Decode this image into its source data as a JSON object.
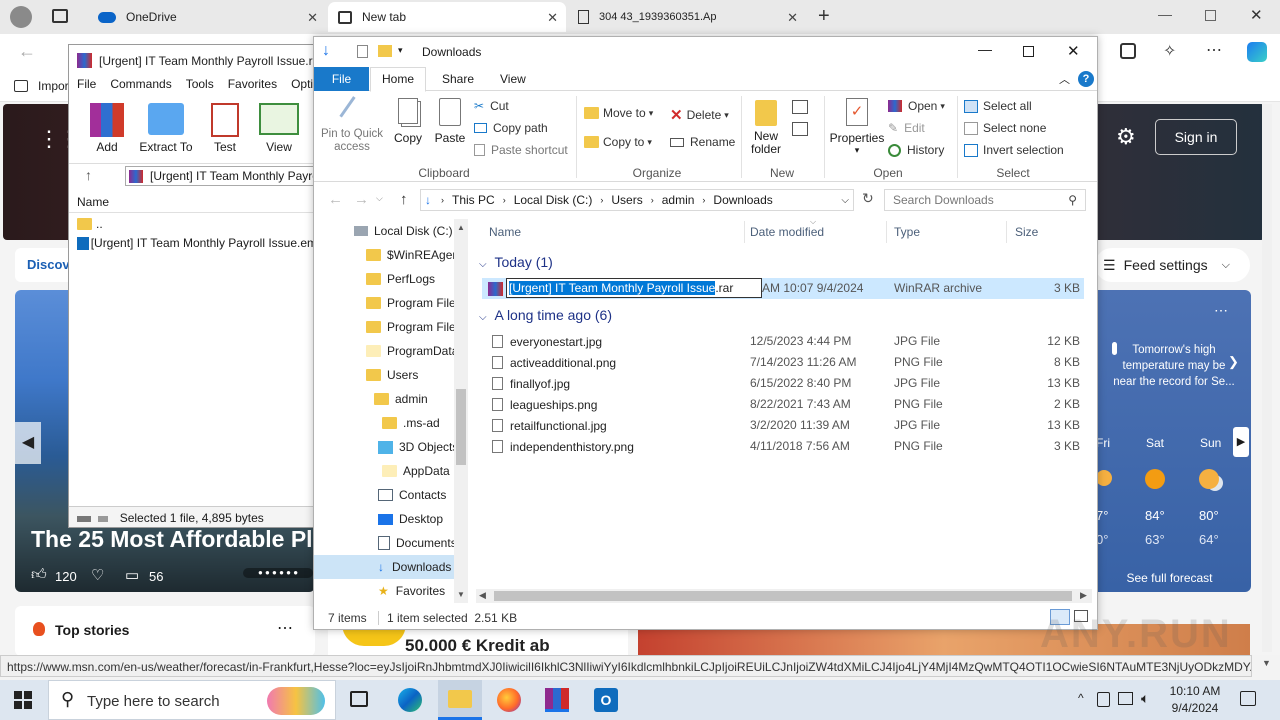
{
  "browser": {
    "tabs": [
      {
        "label": "OneDrive"
      },
      {
        "label": "New tab"
      },
      {
        "label": "304 43_1939360351.Ap"
      }
    ],
    "favbar_label": "Impor"
  },
  "msn": {
    "sign_in": "Sign in",
    "discover": "Discov",
    "feed_settings": "Feed settings",
    "headline": "The 25 Most Affordable Pl",
    "likes": "120",
    "comments": "56",
    "top_stories": "Top stories",
    "ad_text": "50.000 € Kredit ab",
    "weather_note": "Tomorrow's high temperature may be near the record for Se...",
    "forecast": [
      {
        "day": "Fri",
        "high": "7°",
        "low": "0°"
      },
      {
        "day": "Sat",
        "high": "84°",
        "low": "63°"
      },
      {
        "day": "Sun",
        "high": "80°",
        "low": "64°"
      }
    ],
    "see_full_forecast": "See full forecast",
    "status_url": "https://www.msn.com/en-us/weather/forecast/in-Frankfurt,Hesse?loc=eyJsIjoiRnJhbmtmdXJ0IiwicilI6IkhlC3NlIiwiYyI6IkdlcmlhbnkiLCJpIjoiREUiLCJnIjoiZW4tdXMiLCJ4Ijo4LjY4MjI4MzQwMTQ4OTI1OCwieSI6NTAuMTE3NjUyODkzMDY..."
  },
  "winrar": {
    "title": "[Urgent] IT Team Monthly Payroll Issue.ra",
    "menu": [
      "File",
      "Commands",
      "Tools",
      "Favorites",
      "Optio"
    ],
    "tools": [
      "Add",
      "Extract To",
      "Test",
      "View"
    ],
    "path": "[Urgent] IT Team Monthly Payro",
    "col_name": "Name",
    "files": [
      "..",
      " [Urgent] IT Team Monthly Payroll Issue.em"
    ],
    "status": "Selected 1 file, 4,895 bytes"
  },
  "explorer": {
    "title": "Downloads",
    "tabs": [
      "File",
      "Home",
      "Share",
      "View"
    ],
    "clipboard": {
      "pin": "Pin to Quick access",
      "copy": "Copy",
      "paste": "Paste",
      "cut": "Cut",
      "copy_path": "Copy path",
      "paste_shortcut": "Paste shortcut",
      "group": "Clipboard"
    },
    "organize": {
      "move_to": "Move to",
      "copy_to": "Copy to",
      "delete": "Delete",
      "rename": "Rename",
      "group": "Organize"
    },
    "new": {
      "new_folder": "New folder",
      "group": "New"
    },
    "open": {
      "properties": "Properties",
      "open": "Open",
      "edit": "Edit",
      "history": "History",
      "group": "Open"
    },
    "select": {
      "select_all": "Select all",
      "select_none": "Select none",
      "invert": "Invert selection",
      "group": "Select"
    },
    "breadcrumb": [
      "This PC",
      "Local Disk (C:)",
      "Users",
      "admin",
      "Downloads"
    ],
    "search_placeholder": "Search Downloads",
    "nav": [
      "Local Disk (C:)",
      "$WinREAgent",
      "PerfLogs",
      "Program Files",
      "Program Files",
      "ProgramData",
      "Users",
      "admin",
      ".ms-ad",
      "3D Objects",
      "AppData",
      "Contacts",
      "Desktop",
      "Documents",
      "Downloads",
      "Favorites"
    ],
    "columns": [
      "Name",
      "Date modified",
      "Type",
      "Size"
    ],
    "group_today": "Today (1)",
    "group_old": "A long time ago (6)",
    "rename_selected": "[Urgent] IT Team Monthly Payroll Issue",
    "rename_ext": ".rar",
    "today_files": [
      {
        "date": "9/4/2024 10:07 AM",
        "type": "WinRAR archive",
        "size": "3 KB"
      }
    ],
    "files": [
      {
        "name": "everyonestart.jpg",
        "date": "12/5/2023 4:44 PM",
        "type": "JPG File",
        "size": "12 KB"
      },
      {
        "name": "activeadditional.png",
        "date": "7/14/2023 11:26 AM",
        "type": "PNG File",
        "size": "8 KB"
      },
      {
        "name": "finallyof.jpg",
        "date": "6/15/2022 8:40 PM",
        "type": "JPG File",
        "size": "13 KB"
      },
      {
        "name": "leagueships.png",
        "date": "8/22/2021 7:43 AM",
        "type": "PNG File",
        "size": "2 KB"
      },
      {
        "name": "retailfunctional.jpg",
        "date": "3/2/2020 11:39 AM",
        "type": "JPG File",
        "size": "13 KB"
      },
      {
        "name": "independenthistory.png",
        "date": "4/11/2018 7:56 AM",
        "type": "PNG File",
        "size": "3 KB"
      }
    ],
    "status_items": "7 items",
    "status_selected": "1 item selected  2.51 KB"
  },
  "taskbar": {
    "search_placeholder": "Type here to search",
    "time": "10:10 AM",
    "date": "9/4/2024"
  },
  "watermark": "ANY.RUN"
}
